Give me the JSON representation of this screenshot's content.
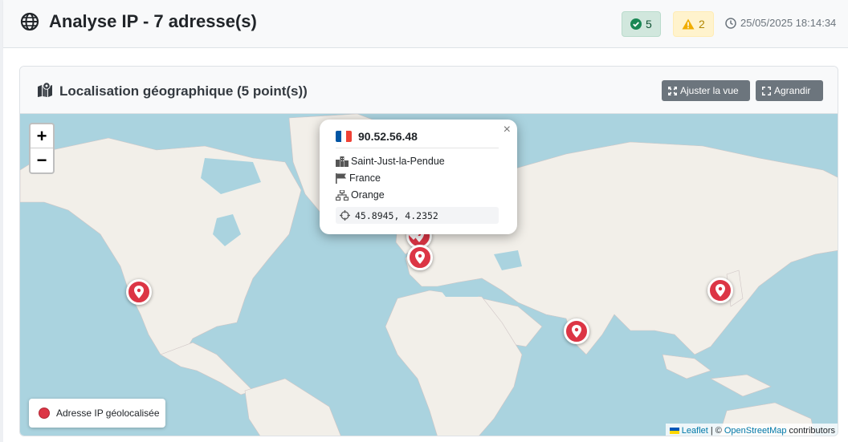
{
  "header": {
    "title": "Analyse IP - 7 adresse(s)",
    "success_count": "5",
    "warning_count": "2",
    "timestamp": "25/05/2025 18:14:34"
  },
  "card": {
    "title": "Localisation géographique (5 point(s))",
    "fit_button": "Ajuster la vue",
    "expand_button": "Agrandir"
  },
  "map": {
    "zoom_in": "+",
    "zoom_out": "−",
    "popup": {
      "ip": "90.52.56.48",
      "city": "Saint-Just-la-Pendue",
      "country": "France",
      "isp": "Orange",
      "coords": "45.8945, 4.2352",
      "close": "×"
    },
    "legend_label": "Adresse IP géolocalisée",
    "attribution": {
      "leaflet": "Leaflet",
      "sep": "| ©",
      "osm": "OpenStreetMap",
      "contrib": "contributors"
    }
  },
  "colors": {
    "marker": "#dc3545",
    "water": "#aad3df",
    "land": "#f2efe9"
  }
}
